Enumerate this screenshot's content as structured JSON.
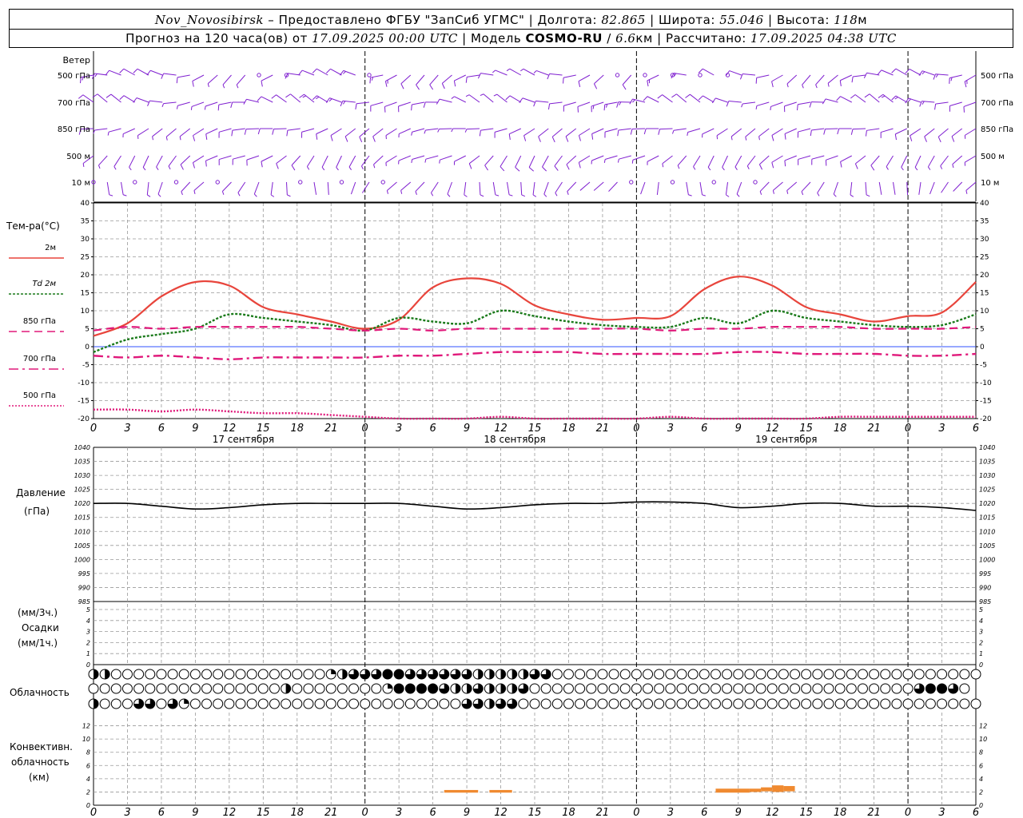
{
  "header": {
    "station": "Nov_Novosibirsk",
    "dash": "–",
    "provider": "Предоставлено ФГБУ \"ЗапСиб УГМС\"",
    "sep": "|",
    "lon_label": "Долгота:",
    "lon_value": "82.865",
    "lat_label": "Широта:",
    "lat_value": "55.046",
    "alt_label": "Высота:",
    "alt_value": "118",
    "alt_unit": "м",
    "forecast_prefix": "Прогноз на 120 часа(ов) от",
    "forecast_from": "17.09.2025 00:00 UTC",
    "model_label": "Модель",
    "model_name": "COSMO-RU",
    "model_res_sep": "/",
    "model_res": "6.6",
    "model_res_unit": "км",
    "computed_label": "Рассчитано:",
    "computed_time": "17.09.2025 04:38 UTC"
  },
  "panels": {
    "wind": {
      "title": "Ветер",
      "levels": [
        "500 гПа",
        "700 гПа",
        "850 гПа",
        "500 м",
        "10  м"
      ]
    },
    "temperature": {
      "title": "Тем-ра(°С)",
      "legend": [
        {
          "label": "2м",
          "color": "#e8453c",
          "dash": "solid"
        },
        {
          "label": "Td  2м",
          "color": "#1a7a1a",
          "dash": "dotted"
        },
        {
          "label": "850 гПа",
          "color": "#e0187a",
          "dash": "dashed"
        },
        {
          "label": "700 гПа",
          "color": "#e0187a",
          "dash": "dashdot"
        },
        {
          "label": "500 гПа",
          "color": "#e0187a",
          "dash": "fine"
        }
      ]
    },
    "pressure": {
      "title": "Давление",
      "unit": "(гПа)"
    },
    "precip": {
      "unit1": "(мм/3ч.)",
      "title": "Осадки",
      "unit2": "(мм/1ч.)"
    },
    "clouds": {
      "title": "Облачность"
    },
    "convective": {
      "line1": "Конвективн.",
      "line2": "облачность",
      "unit": "(км)"
    }
  },
  "time_axis": {
    "hour_labels": [
      "0",
      "3",
      "6",
      "9",
      "12",
      "15",
      "18",
      "21",
      "0",
      "3",
      "6",
      "9",
      "12",
      "15",
      "18",
      "21",
      "0",
      "3",
      "6",
      "9",
      "12",
      "15",
      "18",
      "21",
      "0",
      "3",
      "6"
    ],
    "day_labels": [
      "17 сентября",
      "18 сентября",
      "19 сентября"
    ]
  },
  "colors": {
    "wind": "#7f1fd0",
    "t2m": "#e8453c",
    "td2m": "#1a7a1a",
    "t_levels": "#e0187a",
    "pressure": "#000000",
    "convective": "#f08a30",
    "grid": "#999999"
  },
  "chart_data": [
    {
      "type": "line",
      "panel": "temperature",
      "x_unit": "hours since 17.09.2025 00:00 UTC",
      "ylim": [
        -20,
        40
      ],
      "yticks": [
        -20,
        -15,
        -10,
        -5,
        0,
        5,
        10,
        15,
        20,
        25,
        30,
        35,
        40
      ],
      "grid": true,
      "x": [
        0,
        3,
        6,
        9,
        12,
        15,
        18,
        21,
        24,
        27,
        30,
        33,
        36,
        39,
        42,
        45,
        48,
        51,
        54,
        57,
        60,
        63,
        66,
        69,
        72,
        75,
        78
      ],
      "series": [
        {
          "name": "2м",
          "values": [
            3,
            6.5,
            14,
            18,
            17,
            11,
            9,
            7,
            5,
            7.5,
            16.5,
            19,
            17.5,
            11.5,
            9,
            7.5,
            8,
            8.5,
            16,
            19.5,
            17,
            11,
            9,
            7,
            8.5,
            9.5,
            18
          ]
        },
        {
          "name": "Td  2м",
          "values": [
            -1.5,
            2,
            3.5,
            5,
            9,
            8,
            7,
            6,
            4.5,
            8,
            7,
            6.5,
            10,
            8.5,
            7,
            6,
            5.5,
            5.5,
            8,
            6.5,
            10,
            8,
            7,
            6,
            5.5,
            6,
            9
          ]
        },
        {
          "name": "850 гПа",
          "values": [
            4.5,
            5.5,
            5,
            5.5,
            5.5,
            5.5,
            5.5,
            5,
            4.5,
            5,
            4.5,
            5,
            5,
            5,
            5,
            5,
            5,
            4.5,
            5,
            5,
            5.5,
            5.5,
            5.5,
            5,
            5,
            5,
            5.5
          ]
        },
        {
          "name": "700 гПа",
          "values": [
            -2.5,
            -3,
            -2.5,
            -3,
            -3.5,
            -3,
            -3,
            -3,
            -3,
            -2.5,
            -2.5,
            -2,
            -1.5,
            -1.5,
            -1.5,
            -2,
            -2,
            -2,
            -2,
            -1.5,
            -1.5,
            -2,
            -2,
            -2,
            -2.5,
            -2.5,
            -2
          ]
        },
        {
          "name": "500 гПа",
          "values": [
            -17.5,
            -17.5,
            -18,
            -17.5,
            -18,
            -18.5,
            -18.5,
            -19,
            -19.5,
            -20,
            -20,
            -20,
            -19.5,
            -20,
            -20,
            -20,
            -20,
            -19.5,
            -20,
            -20,
            -20,
            -20,
            -19.5,
            -19.5,
            -19.5,
            -19.5,
            -19.5
          ]
        }
      ]
    },
    {
      "type": "line",
      "panel": "pressure",
      "x_unit": "hours since 17.09.2025 00:00 UTC",
      "ylim": [
        985,
        1040
      ],
      "yticks": [
        985,
        990,
        995,
        1000,
        1005,
        1010,
        1015,
        1020,
        1025,
        1030,
        1035,
        1040
      ],
      "grid": true,
      "x": [
        0,
        3,
        6,
        9,
        12,
        15,
        18,
        21,
        24,
        27,
        30,
        33,
        36,
        39,
        42,
        45,
        48,
        51,
        54,
        57,
        60,
        63,
        66,
        69,
        72,
        75,
        78
      ],
      "series": [
        {
          "values": [
            1020,
            1020,
            1019,
            1018,
            1018.5,
            1019.5,
            1020,
            1020,
            1020,
            1020,
            1019,
            1018,
            1018.5,
            1019.5,
            1020,
            1020,
            1020.5,
            1020.5,
            1020,
            1018.5,
            1019,
            1020,
            1020,
            1019,
            1019,
            1018.5,
            1017.5
          ]
        }
      ]
    },
    {
      "type": "bar",
      "panel": "precipitation",
      "ylim": [
        0,
        5
      ],
      "yticks": [
        0,
        1,
        2,
        3,
        4,
        5
      ],
      "series": [
        {
          "name": "(мм/3ч.)",
          "values": []
        }
      ]
    },
    {
      "type": "table",
      "panel": "cloud_cover",
      "note": "fraction of sky covered, 0..1, three layers (rows top to bottom), hourly 0..78",
      "rows": [
        {
          "values": [
            0.5,
            0.5,
            0,
            0,
            0,
            0,
            0,
            0,
            0,
            0,
            0,
            0,
            0,
            0,
            0,
            0,
            0,
            0,
            0,
            0,
            0,
            0.25,
            0.5,
            0.75,
            0.75,
            0.75,
            1,
            1,
            0.75,
            0.75,
            0.75,
            0.75,
            0.75,
            0.75,
            0.5,
            0.5,
            0.5,
            0.5,
            0.5,
            0.75,
            0.75,
            0,
            0,
            0,
            0,
            0,
            0,
            0,
            0,
            0,
            0,
            0,
            0,
            0,
            0,
            0,
            0,
            0,
            0,
            0,
            0,
            0,
            0,
            0,
            0,
            0,
            0,
            0,
            0,
            0,
            0,
            0,
            0,
            0,
            0,
            0,
            0,
            0,
            0
          ]
        },
        {
          "values": [
            0,
            0,
            0,
            0,
            0,
            0,
            0,
            0,
            0,
            0,
            0,
            0,
            0,
            0,
            0,
            0,
            0,
            0.5,
            0,
            0,
            0,
            0,
            0,
            0,
            0,
            0,
            0.25,
            1,
            1,
            1,
            1,
            0.75,
            0.5,
            0.5,
            0.75,
            0.5,
            0.5,
            0.5,
            0.75,
            0,
            0,
            0,
            0,
            0,
            0,
            0,
            0,
            0,
            0,
            0,
            0,
            0,
            0,
            0,
            0,
            0,
            0,
            0,
            0,
            0,
            0,
            0,
            0,
            0,
            0,
            0,
            0,
            0,
            0,
            0,
            0,
            0,
            0,
            0.75,
            1,
            1,
            0.75,
            0
          ]
        },
        {
          "values": [
            0.5,
            0,
            0,
            0,
            0.75,
            0.75,
            0,
            0.75,
            0.25,
            0,
            0,
            0,
            0,
            0,
            0,
            0,
            0,
            0,
            0,
            0,
            0,
            0,
            0,
            0,
            0,
            0,
            0,
            0,
            0,
            0,
            0,
            0,
            0,
            0.75,
            0.75,
            0.5,
            0.75,
            0.75,
            0,
            0,
            0,
            0,
            0,
            0,
            0,
            0,
            0,
            0,
            0,
            0,
            0,
            0,
            0,
            0,
            0,
            0,
            0,
            0,
            0,
            0,
            0,
            0,
            0,
            0,
            0,
            0,
            0,
            0,
            0,
            0,
            0,
            0,
            0,
            0,
            0,
            0,
            0,
            0,
            0
          ]
        }
      ]
    },
    {
      "type": "bar",
      "panel": "convective",
      "ylim": [
        0,
        14
      ],
      "yticks": [
        0,
        2,
        4,
        6,
        8,
        10,
        12
      ],
      "segments_km": [
        {
          "from_h": 31,
          "to_h": 34,
          "bottom": 1.9,
          "top": 2.3
        },
        {
          "from_h": 35,
          "to_h": 37,
          "bottom": 1.9,
          "top": 2.3
        },
        {
          "from_h": 55,
          "to_h": 58,
          "bottom": 1.9,
          "top": 2.5
        },
        {
          "from_h": 58,
          "to_h": 59,
          "bottom": 2.0,
          "top": 2.5
        },
        {
          "from_h": 59,
          "to_h": 60,
          "bottom": 2.1,
          "top": 2.7
        },
        {
          "from_h": 60,
          "to_h": 61,
          "bottom": 2.0,
          "top": 3.0
        },
        {
          "from_h": 61,
          "to_h": 62,
          "bottom": 2.1,
          "top": 2.9
        }
      ]
    }
  ],
  "wind_barbs": {
    "note": "wind barbs: direction (deg, from) and speed (m/s) per level, sampled every 3h",
    "rows": [
      {
        "level": "500 гПа",
        "dir": [
          240,
          250,
          250,
          260,
          260,
          270,
          270,
          270,
          280,
          280,
          270,
          270,
          0,
          0,
          0,
          270,
          260,
          300,
          290,
          310,
          300,
          0,
          0,
          0,
          0,
          290,
          300,
          290,
          280,
          280,
          270,
          270,
          300,
          300,
          300,
          290,
          280,
          270,
          260,
          260,
          0,
          260,
          0,
          0,
          0,
          0,
          0,
          0,
          0,
          260,
          260,
          260,
          270,
          270,
          270,
          260,
          250,
          250,
          240,
          270,
          280,
          260,
          270,
          250,
          250
        ],
        "spd": [
          12,
          12,
          12,
          12,
          12,
          10,
          10,
          10,
          8,
          8,
          8,
          8,
          0,
          0,
          0,
          8,
          8,
          8,
          8,
          8,
          8,
          0,
          0,
          0,
          0,
          8,
          8,
          8,
          8,
          8,
          8,
          8,
          8,
          8,
          8,
          8,
          8,
          10,
          10,
          10,
          0,
          10,
          0,
          0,
          0,
          0,
          0,
          0,
          0,
          10,
          12,
          12,
          12,
          12,
          12,
          12,
          12,
          12,
          10,
          10,
          10,
          10,
          10,
          12,
          12
        ]
      }
    ]
  }
}
